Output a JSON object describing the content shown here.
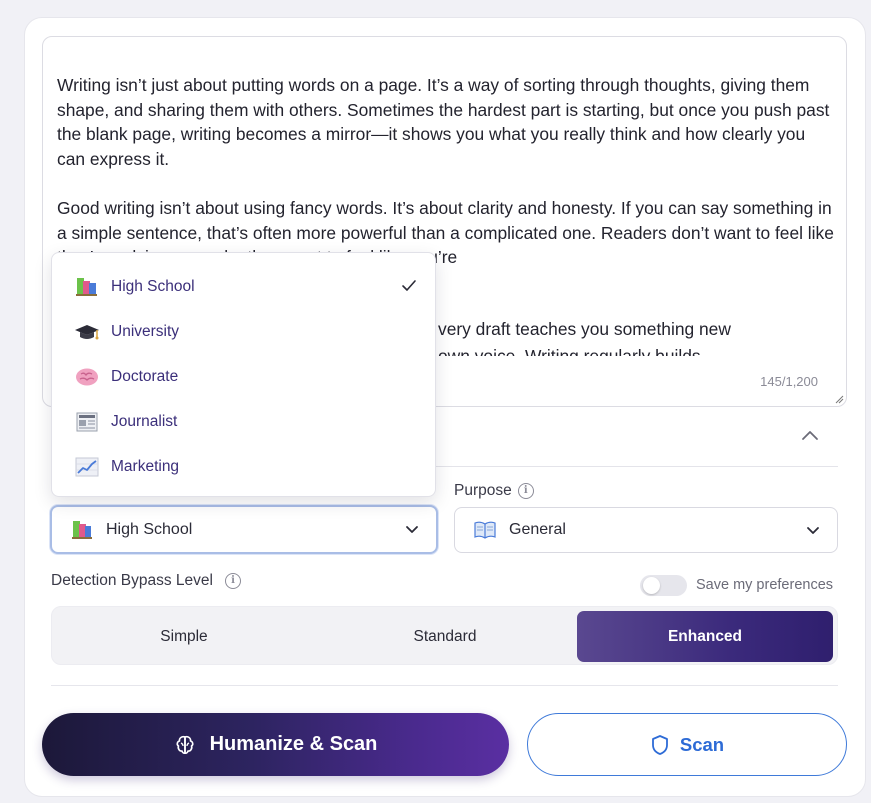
{
  "editor": {
    "paragraphs": [
      "Writing isn’t just about putting words on a page. It’s a way of sorting through thoughts, giving them shape, and sharing them with others. Sometimes the hardest part is starting, but once you push past the blank page, writing becomes a mirror—it shows you what you really think and how clearly you can express it.",
      "Good writing isn’t about using fancy words. It’s about clarity and honesty. If you can say something in a simple sentence, that’s often more powerful than a complicated one. Readers don’t want to feel like they’re solving a puzzle; they want to feel like you’re",
      "very draft teaches you something new",
      "own voice. Writing regularly builds"
    ],
    "counter": "145/1,200"
  },
  "dropdown": {
    "items": [
      {
        "label": "High School",
        "icon": "books-icon",
        "selected": true
      },
      {
        "label": "University",
        "icon": "graduation-cap-icon",
        "selected": false
      },
      {
        "label": "Doctorate",
        "icon": "brain-icon",
        "selected": false
      },
      {
        "label": "Journalist",
        "icon": "newspaper-icon",
        "selected": false
      },
      {
        "label": "Marketing",
        "icon": "chart-increasing-icon",
        "selected": false
      }
    ],
    "check": "✓"
  },
  "settings": {
    "purpose_label": "Purpose",
    "readability_value": "High School",
    "purpose_value": "General",
    "bypass_label": "Detection Bypass Level",
    "save_prefs_label": "Save my preferences",
    "save_prefs_on": false,
    "levels": [
      "Simple",
      "Standard",
      "Enhanced"
    ],
    "selected_level": "Enhanced"
  },
  "actions": {
    "humanize_label": "Humanize & Scan",
    "scan_label": "Scan"
  },
  "colors": {
    "accent_purple": "#3b2a7c",
    "scan_blue": "#2d6bd6",
    "dropdown_text": "#3b2f7a"
  }
}
